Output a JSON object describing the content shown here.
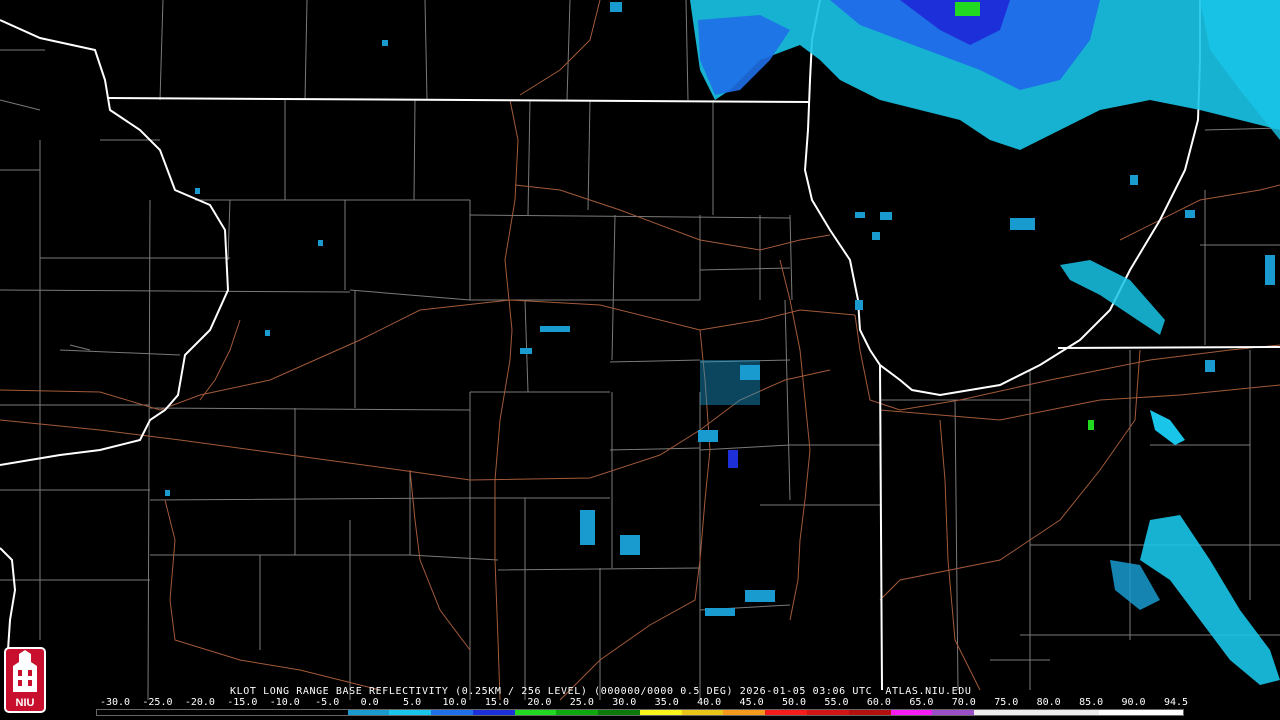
{
  "product": {
    "title": "KLOT LONG RANGE BASE REFLECTIVITY (0.25KM / 256 LEVEL) (000000/0000 0.5 DEG) 2026-01-05 03:06 UTC  ATLAS.NIU.EDU"
  },
  "legend": {
    "labels": [
      "-30.0",
      "-25.0",
      "-20.0",
      "-15.0",
      "-10.0",
      "-5.0",
      "0.0",
      "5.0",
      "10.0",
      "15.0",
      "20.0",
      "25.0",
      "30.0",
      "35.0",
      "40.0",
      "45.0",
      "50.0",
      "55.0",
      "60.0",
      "65.0",
      "70.0",
      "75.0",
      "80.0",
      "85.0",
      "90.0",
      "94.5"
    ],
    "colors": [
      "#000000",
      "#000000",
      "#000000",
      "#000000",
      "#000000",
      "#000000",
      "#1a9bd0",
      "#19c5e8",
      "#1f6fe8",
      "#1c2fd8",
      "#21d921",
      "#0fa80f",
      "#0b7a0b",
      "#f7f41c",
      "#e8c519",
      "#f59a1c",
      "#f51c1c",
      "#d11414",
      "#b31010",
      "#f51cf5",
      "#9a4fc9",
      "#eeeeee",
      "#eeeeee",
      "#eeeeee",
      "#ffffff",
      "#ffffff"
    ]
  },
  "colors": {
    "background": "#000000",
    "state_borders": "#ffffff",
    "county_lines": "#7a7a7a",
    "highways": "#a35a3a"
  },
  "logo": {
    "text": "NIU",
    "color": "#c8102e"
  }
}
